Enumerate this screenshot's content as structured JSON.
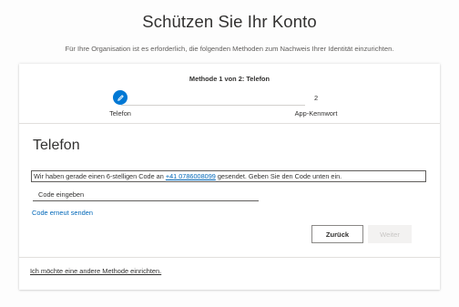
{
  "page": {
    "title": "Schützen Sie Ihr Konto",
    "subtitle": "Für Ihre Organisation ist es erforderlich, die folgenden Methoden zum Nachweis Ihrer Identität einzurichten."
  },
  "wizard": {
    "header": "Methode 1 von 2: Telefon",
    "steps": [
      {
        "label": "Telefon",
        "status": "completed",
        "icon": "pencil-icon"
      },
      {
        "label": "App-Kennwort",
        "number": "2",
        "status": "pending"
      }
    ]
  },
  "method": {
    "title": "Telefon",
    "info_prefix": "Wir haben gerade einen 6-stelligen Code an ",
    "phone_number": "+41 0786008099",
    "info_suffix": " gesendet. Geben Sie den Code unten ein.",
    "code_placeholder": "Code eingeben",
    "code_value": "",
    "resend_label": "Code erneut senden"
  },
  "buttons": {
    "back_label": "Zurück",
    "next_label": "Weiter"
  },
  "footer": {
    "alt_method_label": "Ich möchte eine andere Methode einrichten."
  },
  "colors": {
    "accent": "#0078d4",
    "link": "#0067b8",
    "text": "#323130",
    "disabled_bg": "#f3f2f1",
    "disabled_text": "#c8c6c4"
  }
}
